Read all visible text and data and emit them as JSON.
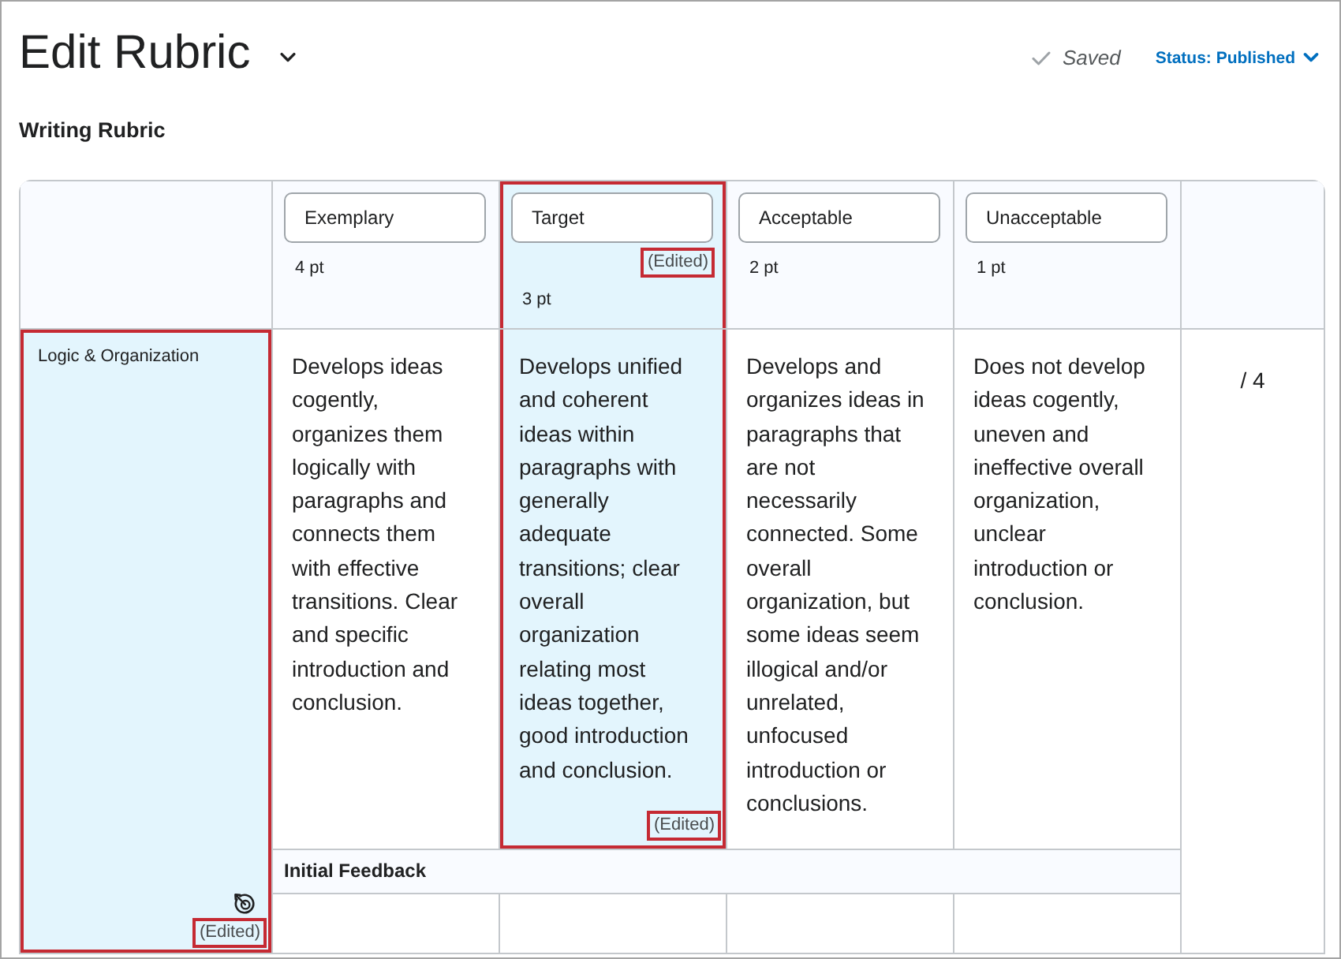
{
  "page": {
    "title": "Edit Rubric",
    "save_state": "Saved",
    "status": "Status: Published"
  },
  "rubric": {
    "name": "Writing Rubric",
    "levels": [
      {
        "name": "Exemplary",
        "points": "4 pt",
        "highlighted": false
      },
      {
        "name": "Target",
        "points": "3 pt",
        "highlighted": true,
        "edited_label": "(Edited)"
      },
      {
        "name": "Acceptable",
        "points": "2 pt",
        "highlighted": false
      },
      {
        "name": "Unacceptable",
        "points": "1 pt",
        "highlighted": false
      }
    ],
    "criteria": [
      {
        "name": "Logic & Organization",
        "highlighted": true,
        "edited_label": "(Edited)",
        "descriptions": [
          {
            "text": "Develops ideas cogently, organizes them logically with paragraphs and connects them with effective transitions. Clear and specific introduction and conclusion."
          },
          {
            "text": "Develops unified and coherent ideas within paragraphs with generally adequate transitions; clear overall organization relating most ideas together, good introduction and conclusion.",
            "edited_label": "(Edited)"
          },
          {
            "text": "Develops and organizes ideas in paragraphs that are not necessarily connected. Some overall organization, but some ideas seem illogical and/or unrelated, unfocused introduction or conclusions."
          },
          {
            "text": "Does not develop ideas cogently, uneven and ineffective overall organization, unclear introduction or conclusion."
          }
        ],
        "out_of": "/ 4",
        "feedback_title": "Initial Feedback"
      }
    ]
  }
}
